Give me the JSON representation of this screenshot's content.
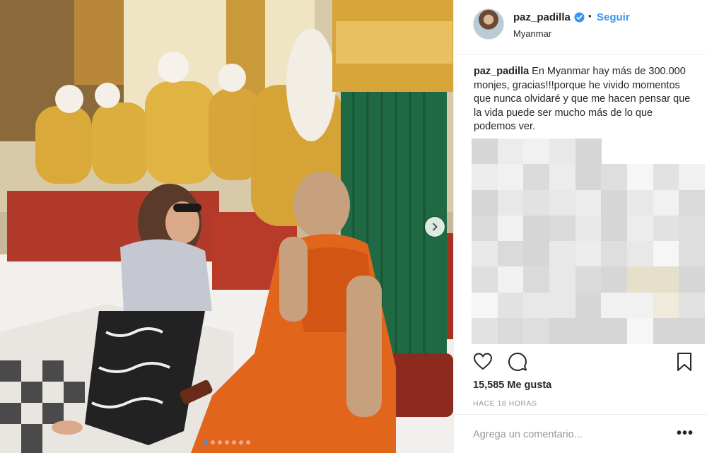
{
  "post": {
    "username": "paz_padilla",
    "follow_label": "Seguir",
    "separator": "•",
    "location": "Myanmar",
    "caption_user": "paz_padilla",
    "caption_text": "En Myanmar hay más de 300.000 monjes, gracias!!!porque he vivido momentos que nunca olvidaré y que me hacen pensar que la vida puede ser mucho más de lo que podemos ver.",
    "likes": "15,585 Me gusta",
    "time": "HACE 18 HORAS",
    "comment_placeholder": "Agrega un comentario...",
    "more_label": "•••"
  },
  "carousel": {
    "slide_count": 7,
    "active_index": 0
  },
  "icons": {
    "verified": "verified-badge-icon",
    "next": "chevron-right-icon",
    "like": "heart-icon",
    "comment": "comment-icon",
    "save": "bookmark-icon",
    "options": "more-options-icon"
  },
  "colors": {
    "link_blue": "#3897f0",
    "text": "#262626",
    "muted": "#999999",
    "divider": "#efefef"
  }
}
